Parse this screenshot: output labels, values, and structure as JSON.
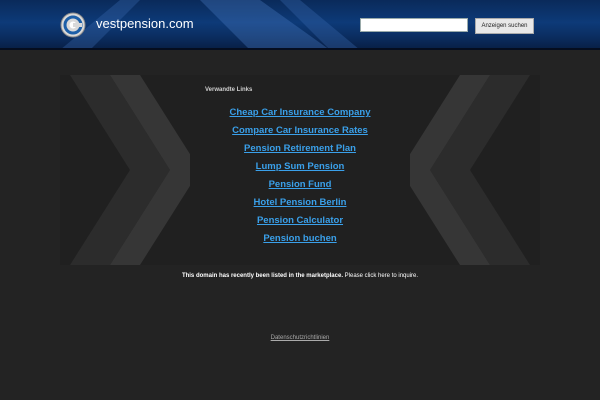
{
  "header": {
    "site_name": "vestpension.com",
    "search": {
      "value": "",
      "button_label": "Anzeigen suchen"
    }
  },
  "links": {
    "heading": "Verwandte Links",
    "items": [
      "Cheap Car Insurance Company",
      "Compare Car Insurance Rates",
      "Pension Retirement Plan",
      "Lump Sum Pension",
      "Pension Fund",
      "Hotel Pension Berlin",
      "Pension Calculator",
      "Pension buchen"
    ]
  },
  "notice": {
    "bold": "This domain has recently been listed in the marketplace.",
    "rest": " Please click here to inquire."
  },
  "footer": {
    "privacy_link": "Datenschutzrichtlinien"
  },
  "colors": {
    "background": "#232323",
    "header_blue": "#0d3a78",
    "link": "#3aa0ea"
  }
}
